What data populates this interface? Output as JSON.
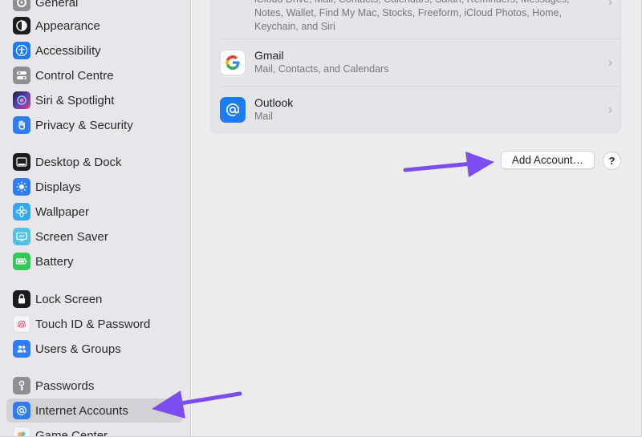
{
  "sidebar": {
    "items": [
      {
        "label": "General",
        "icon": "gear-icon",
        "color": "#8e8e93"
      },
      {
        "label": "Appearance",
        "icon": "appearance-icon",
        "color": "#1c1c1e"
      },
      {
        "label": "Accessibility",
        "icon": "accessibility-icon",
        "color": "#1e7cf2"
      },
      {
        "label": "Control Centre",
        "icon": "control-centre-icon",
        "color": "#8e8e93"
      },
      {
        "label": "Siri & Spotlight",
        "icon": "siri-icon",
        "color": "#5a3fb0"
      },
      {
        "label": "Privacy & Security",
        "icon": "hand-icon",
        "color": "#2f7cf6"
      },
      {
        "label": "Desktop & Dock",
        "icon": "dock-icon",
        "color": "#1c1c1e"
      },
      {
        "label": "Displays",
        "icon": "sun-icon",
        "color": "#2f7cf6"
      },
      {
        "label": "Wallpaper",
        "icon": "flower-icon",
        "color": "#35a7f0"
      },
      {
        "label": "Screen Saver",
        "icon": "screen-saver-icon",
        "color": "#4ec3e6"
      },
      {
        "label": "Battery",
        "icon": "battery-icon",
        "color": "#34c759"
      },
      {
        "label": "Lock Screen",
        "icon": "lock-icon",
        "color": "#1c1c1e"
      },
      {
        "label": "Touch ID & Password",
        "icon": "fingerprint-icon",
        "color": "#f2f2f4"
      },
      {
        "label": "Users & Groups",
        "icon": "users-icon",
        "color": "#2f7cf6"
      },
      {
        "label": "Passwords",
        "icon": "key-icon",
        "color": "#8e8e93"
      },
      {
        "label": "Internet Accounts",
        "icon": "at-icon",
        "color": "#2f7cf6",
        "selected": true
      },
      {
        "label": "Game Center",
        "icon": "game-center-icon",
        "color": "#f2f2f4"
      }
    ]
  },
  "accounts": [
    {
      "name": "",
      "detail_line1": "iCloud Drive, Mail, Contacts, Calendars, Safari, Reminders, Messages,",
      "detail_line2": "Notes, Wallet, Find My Mac, Stocks, Freeform, iCloud Photos, Home,",
      "detail_line3": "Keychain, and Siri"
    },
    {
      "name": "Gmail",
      "detail": "Mail, Contacts, and Calendars",
      "icon": "google-icon"
    },
    {
      "name": "Outlook",
      "detail": "Mail",
      "icon": "at-icon",
      "color": "#1e7cf2"
    }
  ],
  "actions": {
    "add_account_label": "Add Account…",
    "help_label": "?"
  },
  "chevron_glyph": "›",
  "annotation_color": "#7b4cf0"
}
